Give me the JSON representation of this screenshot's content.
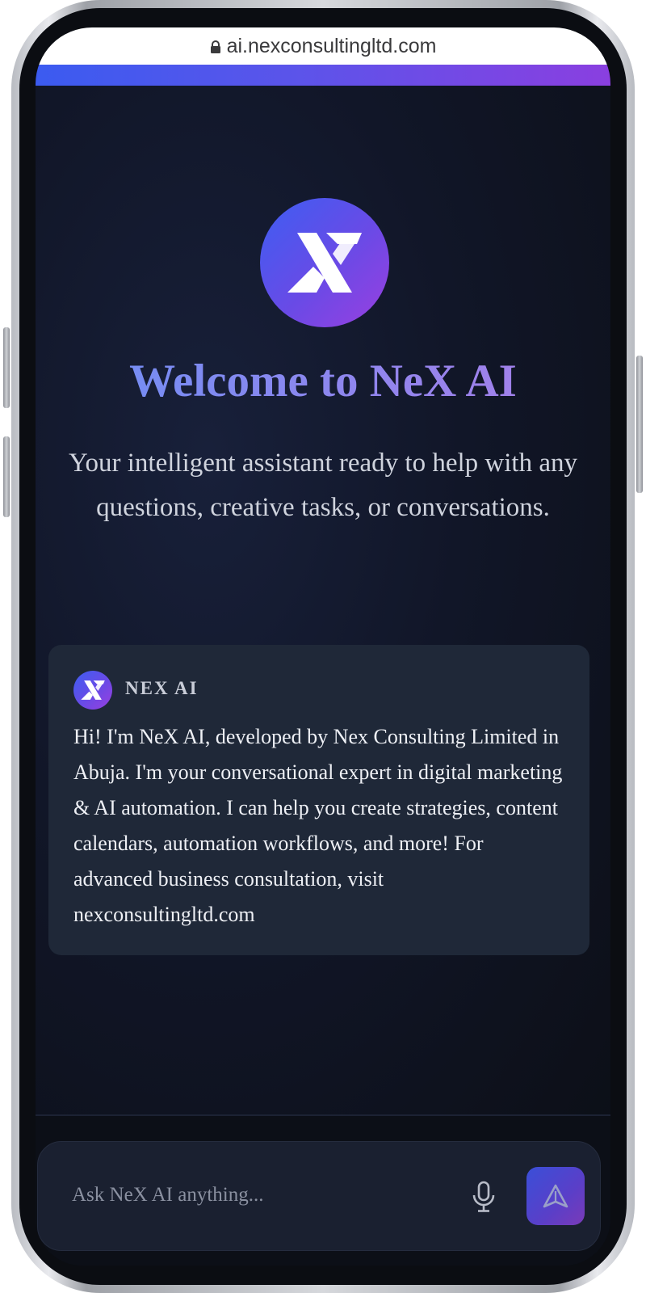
{
  "browser": {
    "url": "ai.nexconsultingltd.com",
    "lock_icon": "lock-icon"
  },
  "colors": {
    "accent_start": "#3b5bf0",
    "accent_end": "#8a3fe0",
    "background": "#0f1420",
    "card": "#1f2838"
  },
  "hero": {
    "logo_icon": "nex-x-logo-icon",
    "title": "Welcome to NeX AI",
    "subtitle": "Your intelligent assistant ready to help with any questions, creative tasks, or conversations."
  },
  "message": {
    "sender": "NEX AI",
    "avatar_icon": "nex-x-logo-icon",
    "text": "Hi! I'm NeX AI, developed by Nex Consulting Limited in Abuja. I'm your conversational expert in digital marketing & AI automation. I can help you create strategies, content calendars, automation workflows, and more! For advanced business consultation, visit nexconsultingltd.com"
  },
  "composer": {
    "placeholder": "Ask NeX AI anything...",
    "value": "",
    "mic_icon": "microphone-icon",
    "send_icon": "send-icon"
  }
}
